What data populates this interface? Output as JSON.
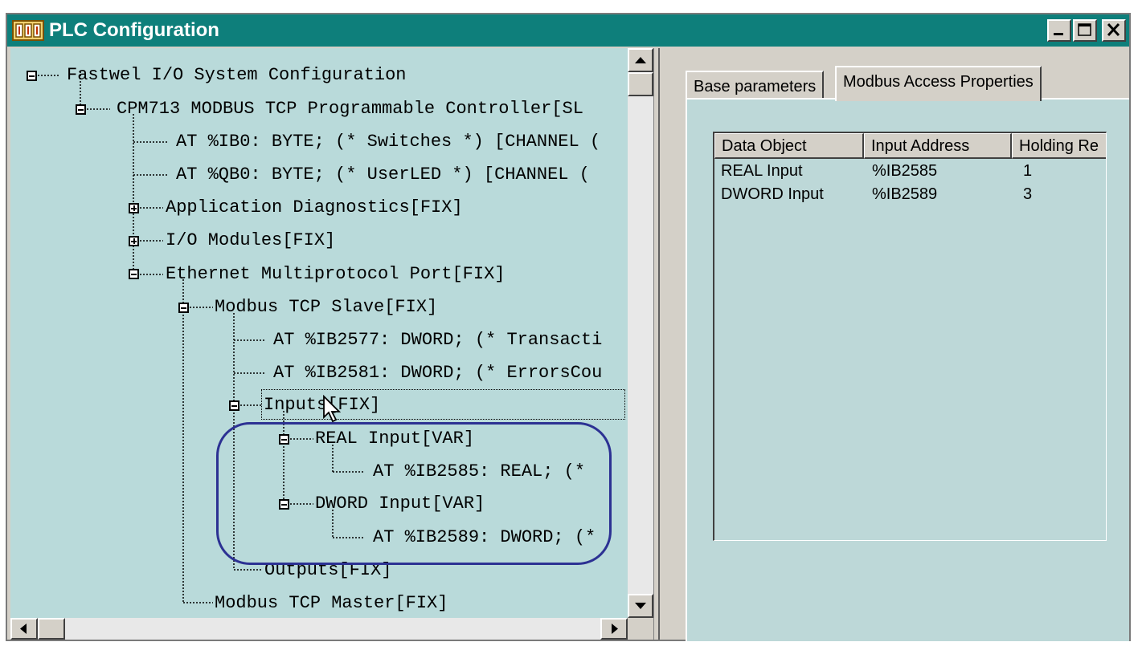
{
  "window": {
    "title": "PLC Configuration",
    "controls": [
      "minimize",
      "maximize",
      "close"
    ]
  },
  "tree": [
    {
      "label": "Fastwel I/O System Configuration",
      "state": "expanded"
    },
    {
      "label": "CPM713 MODBUS TCP Programmable Controller[SL",
      "state": "expanded"
    },
    {
      "label": "AT %IB0: BYTE; (* Switches *) [CHANNEL (",
      "state": "leaf"
    },
    {
      "label": "AT %QB0: BYTE; (* UserLED *) [CHANNEL (",
      "state": "leaf"
    },
    {
      "label": "Application Diagnostics[FIX]",
      "state": "collapsed"
    },
    {
      "label": "I/O Modules[FIX]",
      "state": "collapsed"
    },
    {
      "label": "Ethernet Multiprotocol Port[FIX]",
      "state": "expanded"
    },
    {
      "label": "Modbus TCP Slave[FIX]",
      "state": "expanded"
    },
    {
      "label": "AT %IB2577: DWORD; (* Transacti",
      "state": "leaf"
    },
    {
      "label": "AT %IB2581: DWORD; (* ErrorsCou",
      "state": "leaf"
    },
    {
      "label": "Inputs[FIX]",
      "state": "expanded",
      "focused": true
    },
    {
      "label": "REAL Input[VAR]",
      "state": "expanded"
    },
    {
      "label": "AT %IB2585: REAL; (*",
      "state": "leaf"
    },
    {
      "label": "DWORD Input[VAR]",
      "state": "expanded"
    },
    {
      "label": "AT %IB2589: DWORD; (*",
      "state": "leaf"
    },
    {
      "label": "Outputs[FIX]",
      "state": "leaf"
    },
    {
      "label": "Modbus TCP Master[FIX]",
      "state": "leaf"
    }
  ],
  "tabs": [
    {
      "label": "Base parameters",
      "active": false
    },
    {
      "label": "Modbus Access Properties",
      "active": true
    }
  ],
  "table": {
    "columns": [
      "Data Object",
      "Input Address",
      "Holding Re"
    ],
    "rows": [
      [
        "REAL Input",
        "%IB2585",
        "1"
      ],
      [
        "DWORD Input",
        "%IB2589",
        "3"
      ]
    ]
  },
  "colors": {
    "titlebar": "#0e7f7b",
    "tree_background": "#b9dada",
    "highlight_outline": "#2c3193"
  }
}
